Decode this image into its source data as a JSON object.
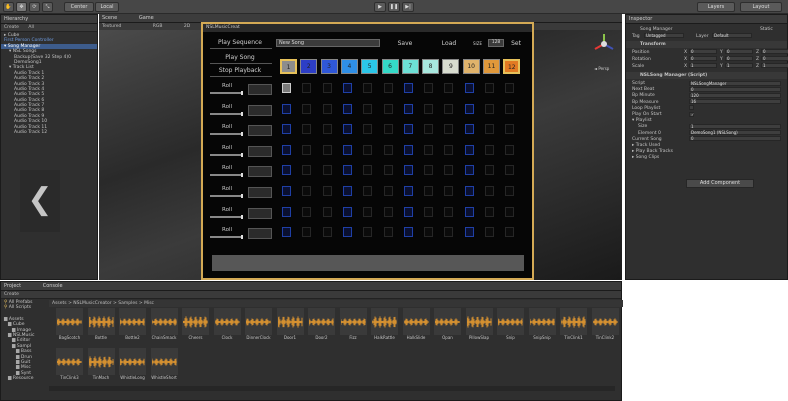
{
  "toolbar": {
    "tools": [
      "hand",
      "move",
      "rotate",
      "scale"
    ],
    "pivot": "Center",
    "space": "Local",
    "layers": "Layers",
    "layout": "Layout"
  },
  "hierarchy": {
    "tab": "Hierarchy",
    "create": "Create",
    "search": "All",
    "items": [
      {
        "label": "▸ Cube",
        "indent": 0
      },
      {
        "label": "First Person Controller",
        "indent": 0,
        "blue": true
      },
      {
        "label": "▾ Song Manager",
        "indent": 0,
        "sel": true
      },
      {
        "label": "▾ NSL Songs",
        "indent": 1
      },
      {
        "label": "Backup(Save 32 Step 4)0",
        "indent": 2
      },
      {
        "label": "DemoSong1",
        "indent": 2
      },
      {
        "label": "▾ Track List",
        "indent": 1
      },
      {
        "label": "Audio Track 1",
        "indent": 2
      },
      {
        "label": "Audio Track 2",
        "indent": 2
      },
      {
        "label": "Audio Track 3",
        "indent": 2
      },
      {
        "label": "Audio Track 4",
        "indent": 2
      },
      {
        "label": "Audio Track 5",
        "indent": 2
      },
      {
        "label": "Audio Track 6",
        "indent": 2
      },
      {
        "label": "Audio Track 7",
        "indent": 2
      },
      {
        "label": "Audio Track 8",
        "indent": 2
      },
      {
        "label": "Audio Track 9",
        "indent": 2
      },
      {
        "label": "Audio Track 10",
        "indent": 2
      },
      {
        "label": "Audio Track 11",
        "indent": 2
      },
      {
        "label": "Audio Track 12",
        "indent": 2
      }
    ]
  },
  "scene": {
    "tab_scene": "Scene",
    "tab_game": "Game",
    "shading": "Textured",
    "rgb": "RGB",
    "mode": "2D",
    "persp": "◄ Persp"
  },
  "nsl": {
    "title": "NSLMusicCreat",
    "play_sequence": "Play Sequence",
    "play_song": "Play Song",
    "stop_playback": "Stop Playback",
    "song_name": "New Song",
    "save": "Save",
    "load": "Load",
    "size_label": "SIZE",
    "size_value": "128",
    "set": "Set",
    "pads": [
      {
        "n": "1",
        "c": "#8d8d8d"
      },
      {
        "n": "2",
        "c": "#2d3ec6"
      },
      {
        "n": "3",
        "c": "#2f57d8"
      },
      {
        "n": "4",
        "c": "#2f8fe6"
      },
      {
        "n": "5",
        "c": "#2bc6e8"
      },
      {
        "n": "6",
        "c": "#34dac8"
      },
      {
        "n": "7",
        "c": "#6de0d6"
      },
      {
        "n": "8",
        "c": "#a8e8df"
      },
      {
        "n": "9",
        "c": "#d9ddd0"
      },
      {
        "n": "10",
        "c": "#e0b36b"
      },
      {
        "n": "11",
        "c": "#e0983a"
      },
      {
        "n": "12",
        "c": "#e27a22"
      }
    ],
    "roll_label": "Roll"
  },
  "inspector": {
    "tab": "Inspector",
    "object_name": "Song Manager",
    "static": "Static",
    "tag_label": "Tag",
    "tag_value": "Untagged",
    "layer_label": "Layer",
    "layer_value": "Default",
    "transform": "Transform",
    "position": "Position",
    "rotation": "Rotation",
    "scale": "Scale",
    "pos": [
      "0",
      "0",
      "0"
    ],
    "rot": [
      "0",
      "0",
      "0"
    ],
    "scl": [
      "1",
      "1",
      "1"
    ],
    "component": "NSLSong Manager (Script)",
    "fields": [
      {
        "label": "Script",
        "value": "NSLSongManager"
      },
      {
        "label": "Next Beat",
        "value": "0"
      },
      {
        "label": "Bp Minute",
        "value": "120"
      },
      {
        "label": "Bp Measure",
        "value": "16"
      },
      {
        "label": "Loop Playlist",
        "value": ""
      },
      {
        "label": "Play On Start",
        "value": "✓"
      },
      {
        "label": "▾ Playlist",
        "value": ""
      },
      {
        "label": "Size",
        "value": "1"
      },
      {
        "label": "Element 0",
        "value": "DemoSong1 (NSLSong)"
      },
      {
        "label": "Current Song",
        "value": "0"
      },
      {
        "label": "▸ Track Used",
        "value": ""
      },
      {
        "label": "▸ Play Back Tracks",
        "value": ""
      },
      {
        "label": "▸ Song Clips",
        "value": ""
      }
    ],
    "add_component": "Add Component"
  },
  "project": {
    "tab_project": "Project",
    "tab_console": "Console",
    "create": "Create",
    "fav1": "All Prefabs",
    "fav2": "All Scripts",
    "tree": [
      {
        "label": "Assets",
        "indent": 0
      },
      {
        "label": "Cube",
        "indent": 1
      },
      {
        "label": "Image",
        "indent": 2
      },
      {
        "label": "NSLMusic",
        "indent": 1
      },
      {
        "label": "Editor",
        "indent": 2
      },
      {
        "label": "Sampl",
        "indent": 2
      },
      {
        "label": "Bass",
        "indent": 3
      },
      {
        "label": "Drun",
        "indent": 3
      },
      {
        "label": "Guit",
        "indent": 3
      },
      {
        "label": "Misc",
        "indent": 3
      },
      {
        "label": "Synt",
        "indent": 3
      },
      {
        "label": "Resource",
        "indent": 1
      }
    ],
    "breadcrumb": "Assets > NSLMusicCreator > Samples > Misc",
    "assets": [
      "BagScotch",
      "Bottle",
      "Bottle2",
      "ChainSmack",
      "Cheers",
      "Clock",
      "DinnerClock",
      "Door1",
      "Door2",
      "Fizz",
      "HalkRattle",
      "HalkSlide",
      "Opan",
      "PillowSlap",
      "Snip",
      "SnipSnip",
      "TinClink1",
      "TinClink2",
      "TinClink3",
      "TinMach",
      "WhistleLong",
      "WhistleShort"
    ]
  }
}
